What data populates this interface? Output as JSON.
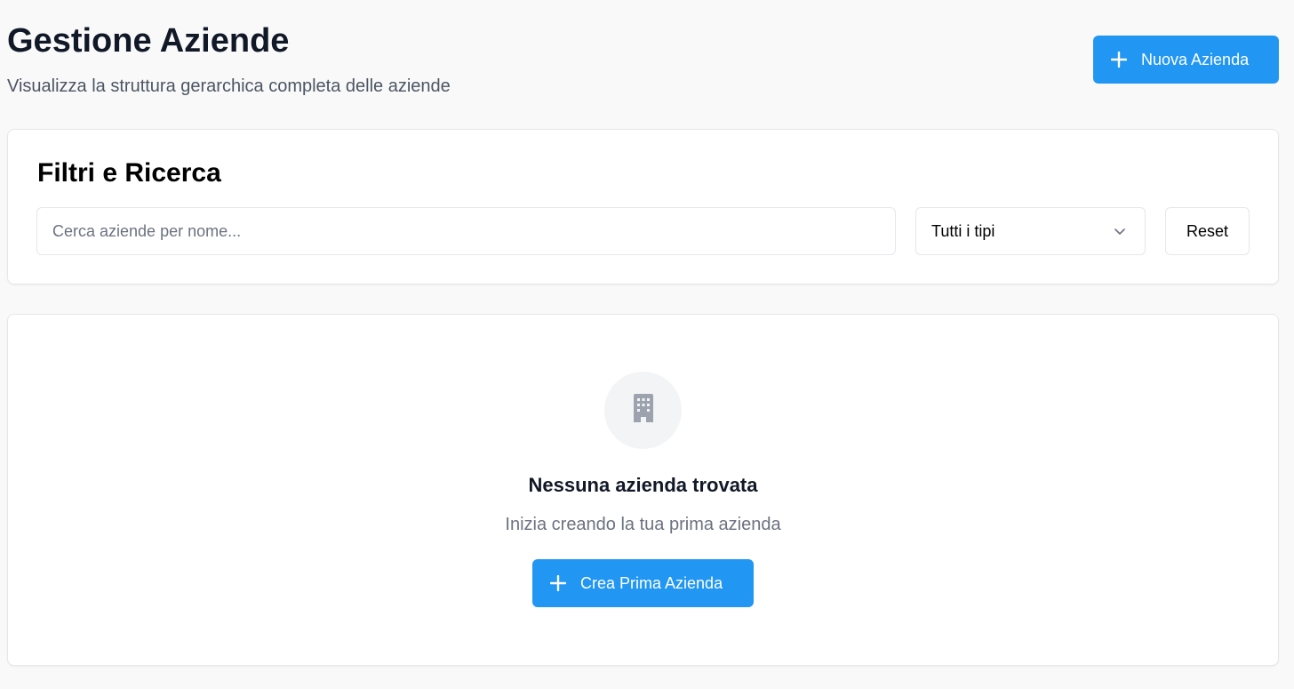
{
  "header": {
    "title": "Gestione Aziende",
    "subtitle": "Visualizza la struttura gerarchica completa delle aziende",
    "new_button_label": "Nuova Azienda"
  },
  "filters": {
    "title": "Filtri e Ricerca",
    "search_placeholder": "Cerca aziende per nome...",
    "search_value": "",
    "type_select_value": "Tutti i tipi",
    "reset_label": "Reset"
  },
  "empty_state": {
    "icon": "building-icon",
    "title": "Nessuna azienda trovata",
    "subtitle": "Inizia creando la tua prima azienda",
    "create_button_label": "Crea Prima Azienda"
  },
  "colors": {
    "primary": "#2196f3",
    "page_background": "#f9f9f9",
    "card_border": "#e5e7eb",
    "muted_text": "#6b7280"
  }
}
